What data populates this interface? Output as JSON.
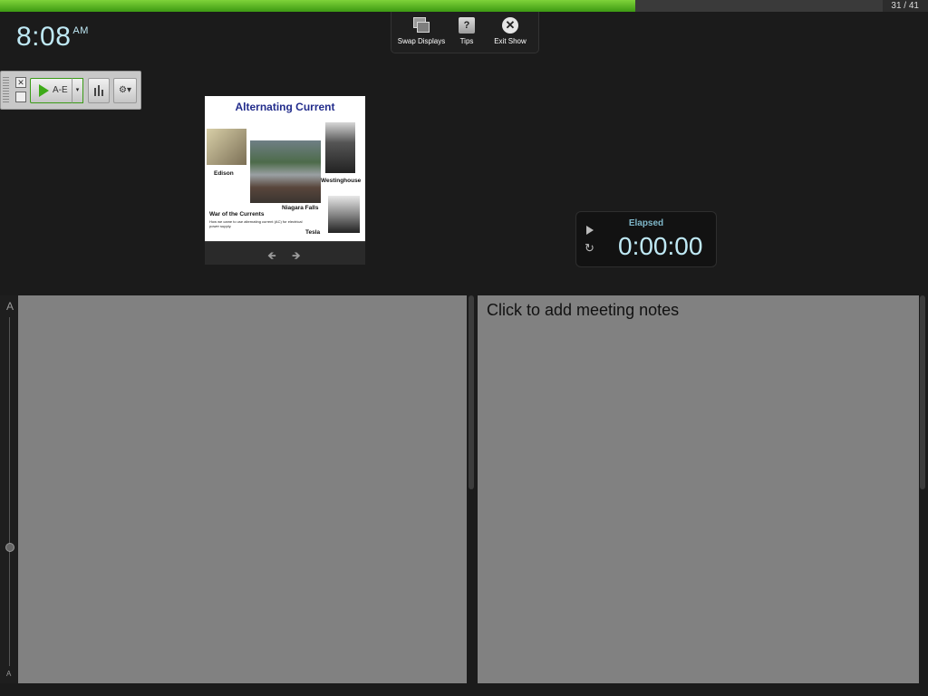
{
  "progress": {
    "fraction": 0.72,
    "counter": "31 / 41"
  },
  "clock": {
    "time": "8:08",
    "ampm": "AM"
  },
  "toolbar": {
    "swap_label": "Swap Displays",
    "tips_label": "Tips",
    "tips_glyph": "?",
    "exit_label": "Exit Show",
    "exit_glyph": "✕"
  },
  "palette": {
    "play_label": "A-E",
    "dropdown_glyph": "▾",
    "gear_glyph": "⚙▾",
    "close_glyph": "✕"
  },
  "slide": {
    "title": "Alternating Current",
    "captions": {
      "edison": "Edison",
      "niagara": "Niagara Falls",
      "westinghouse": "Westinghouse",
      "tesla": "Tesla",
      "war": "War of the Currents",
      "sub": "How we came to use alternating current (AC) for electrical power supply."
    },
    "prev_glyph": "🡸",
    "next_glyph": "🡺"
  },
  "timer": {
    "label": "Elapsed",
    "value": "0:00:00",
    "reset_glyph": "↻"
  },
  "font_size_strip": {
    "top": "A",
    "bottom": "A"
  },
  "notes": {
    "placeholder": "Click to add meeting notes"
  },
  "colors": {
    "progress": "#5cb52a",
    "clock": "#bfe9f5",
    "slide_title": "#232d8c"
  },
  "icons": [
    "swap-displays-icon",
    "tips-icon",
    "close-icon",
    "play-icon",
    "chart-icon",
    "gear-icon",
    "arrow-left-icon",
    "arrow-right-icon",
    "reset-icon"
  ]
}
